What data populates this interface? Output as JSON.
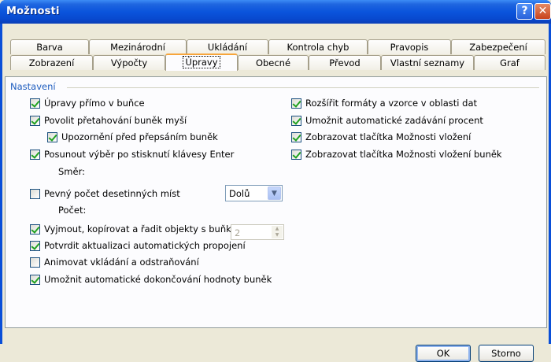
{
  "window": {
    "title": "Možnosti",
    "help_symbol": "?",
    "close_symbol": "✕"
  },
  "tabs": {
    "row1": [
      "Barva",
      "Mezinárodní",
      "Ukládání",
      "Kontrola chyb",
      "Pravopis",
      "Zabezpečení"
    ],
    "row2": [
      "Zobrazení",
      "Výpočty",
      "Úpravy",
      "Obecné",
      "Převod",
      "Vlastní seznamy",
      "Graf"
    ],
    "active": "Úpravy"
  },
  "group": {
    "label": "Nastavení"
  },
  "options_left": [
    {
      "label": "Úpravy přímo v buňce",
      "checked": true
    },
    {
      "label": "Povolit přetahování buněk myší",
      "checked": true
    },
    {
      "label": "Upozornění před přepsáním buněk",
      "checked": true
    },
    {
      "label": "Posunout výběr po stisknutí klávesy Enter",
      "checked": true
    },
    {
      "label": "Pevný počet desetinných míst",
      "checked": false
    },
    {
      "label": "Vyjmout, kopírovat a řadit objekty s buňkami",
      "checked": true
    },
    {
      "label": "Potvrdit aktualizaci automatických propojení",
      "checked": true
    },
    {
      "label": "Animovat vkládání a odstraňování",
      "checked": false
    },
    {
      "label": "Umožnit automatické dokončování hodnoty buněk",
      "checked": true
    }
  ],
  "options_right": [
    {
      "label": "Rozšířit formáty a vzorce v oblasti dat",
      "checked": true
    },
    {
      "label": "Umožnit automatické zadávání procent",
      "checked": true
    },
    {
      "label": "Zobrazovat tlačítka Možnosti vložení",
      "checked": true
    },
    {
      "label": "Zobrazovat tlačítka Možnosti vložení buněk",
      "checked": true
    }
  ],
  "direction": {
    "label": "Směr:",
    "value": "Dolů"
  },
  "places": {
    "label": "Počet:",
    "value": "2"
  },
  "buttons": {
    "ok": "OK",
    "cancel": "Storno"
  }
}
